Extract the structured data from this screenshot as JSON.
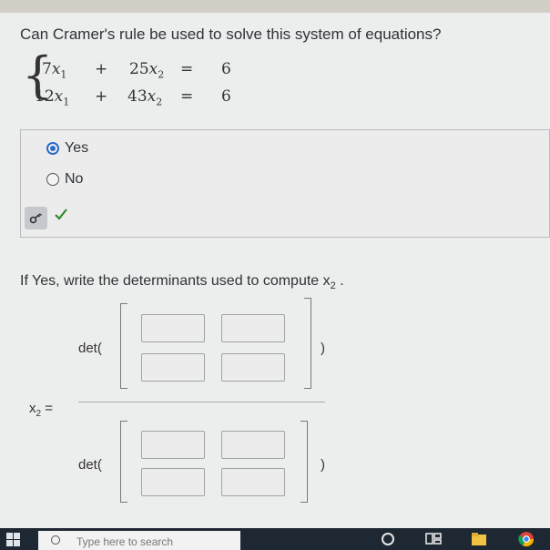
{
  "question": "Can Cramer's rule be used to solve this system of equations?",
  "system": {
    "rows": [
      {
        "c1": "7",
        "v1": "x",
        "s1": "1",
        "op": "+",
        "c2": "25",
        "v2": "x",
        "s2": "2",
        "eq": "=",
        "rhs": "6"
      },
      {
        "c1": "12",
        "v1": "x",
        "s1": "1",
        "op": "+",
        "c2": "43",
        "v2": "x",
        "s2": "2",
        "eq": "=",
        "rhs": "6"
      }
    ]
  },
  "options": [
    {
      "label": "Yes",
      "selected": true
    },
    {
      "label": "No",
      "selected": false
    }
  ],
  "feedback": {
    "correct": true,
    "color": "#2e8b2e"
  },
  "prompt": {
    "text": "If Yes, write the determinants used to compute x",
    "sub": "2",
    "end": "."
  },
  "fraction": {
    "lhs": "x",
    "lhs_sub": "2",
    "lhs_eq": "=",
    "numerator": {
      "label": "det(",
      "close": ")",
      "cells": [
        "",
        "",
        "",
        ""
      ]
    },
    "denominator": {
      "label": "det(",
      "close": ")",
      "cells": [
        "",
        "",
        "",
        ""
      ]
    }
  },
  "taskbar": {
    "search_placeholder": "Type here to search"
  },
  "colors": {
    "accent": "#2a69c7",
    "taskbar": "#1e2833"
  }
}
